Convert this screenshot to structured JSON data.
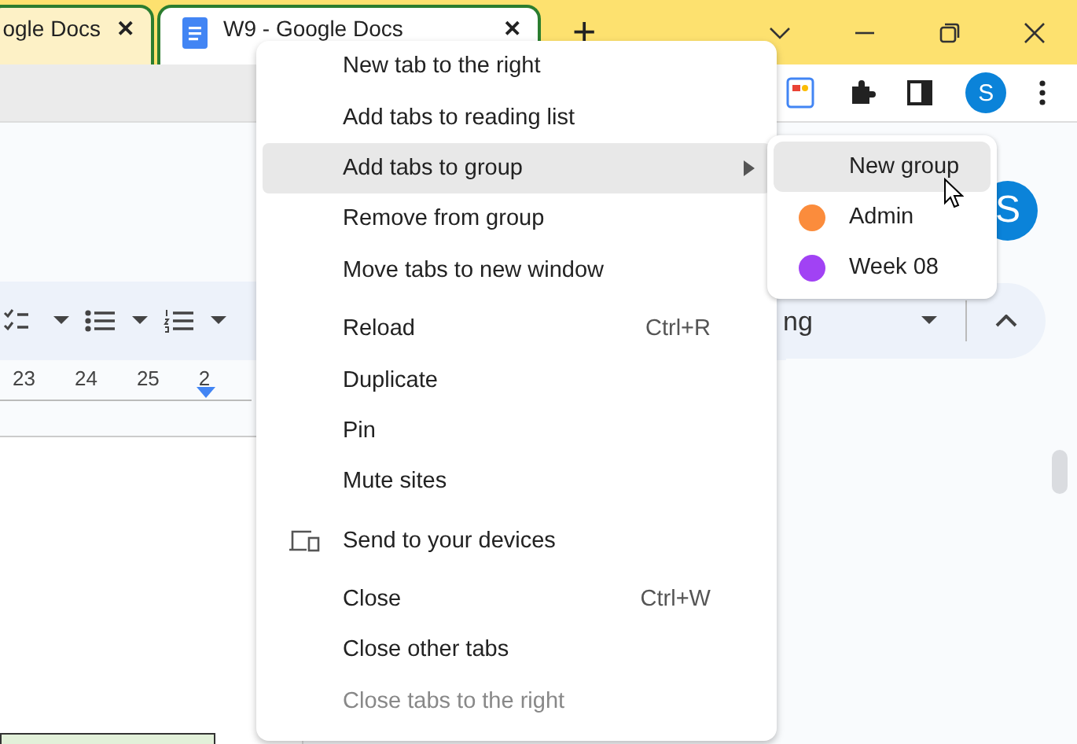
{
  "tabs": [
    {
      "title": "ogle Docs",
      "close": "✕",
      "selected": false
    },
    {
      "title": "W9 - Google Docs",
      "close": "✕",
      "selected": true
    }
  ],
  "new_tab": "+",
  "toolbar": {
    "avatar": "S"
  },
  "document": {
    "avatar": "S",
    "style_dropdown": "ng",
    "ruler": [
      "23",
      "24",
      "25",
      "2"
    ]
  },
  "context_menu": {
    "sections": [
      [
        {
          "kind": "text",
          "label": "New tab to the right",
          "selected": false,
          "disabled": false,
          "submenu": false
        },
        {
          "kind": "text",
          "label": "Add tabs to reading list",
          "selected": false,
          "disabled": false,
          "submenu": false
        },
        {
          "kind": "text",
          "label": "Add tabs to group",
          "selected": true,
          "disabled": false,
          "submenu": true
        },
        {
          "kind": "text",
          "label": "Remove from group",
          "selected": false,
          "disabled": false,
          "submenu": false
        },
        {
          "kind": "text",
          "label": "Move tabs to new window",
          "selected": false,
          "disabled": false,
          "submenu": false
        }
      ],
      [
        {
          "kind": "text",
          "label": "Reload",
          "shortcut": "Ctrl+R",
          "selected": false,
          "disabled": false,
          "submenu": false
        },
        {
          "kind": "text",
          "label": "Duplicate",
          "selected": false,
          "disabled": false,
          "submenu": false
        },
        {
          "kind": "text",
          "label": "Pin",
          "selected": false,
          "disabled": false,
          "submenu": false
        },
        {
          "kind": "text",
          "label": "Mute sites",
          "selected": false,
          "disabled": false,
          "submenu": false
        }
      ],
      [
        {
          "kind": "devices",
          "label": "Send to your devices",
          "selected": false,
          "disabled": false,
          "submenu": false
        }
      ],
      [
        {
          "kind": "text",
          "label": "Close",
          "shortcut": "Ctrl+W",
          "selected": false,
          "disabled": false,
          "submenu": false
        },
        {
          "kind": "text",
          "label": "Close other tabs",
          "selected": false,
          "disabled": false,
          "submenu": false
        },
        {
          "kind": "text",
          "label": "Close tabs to the right",
          "selected": false,
          "disabled": true,
          "submenu": false
        }
      ]
    ]
  },
  "group_submenu": [
    {
      "label": "New group",
      "selected": true
    },
    {
      "label": "Admin",
      "color": "#fb8c3c",
      "selected": false
    },
    {
      "label": "Week 08",
      "color": "#a142f4",
      "selected": false
    }
  ]
}
